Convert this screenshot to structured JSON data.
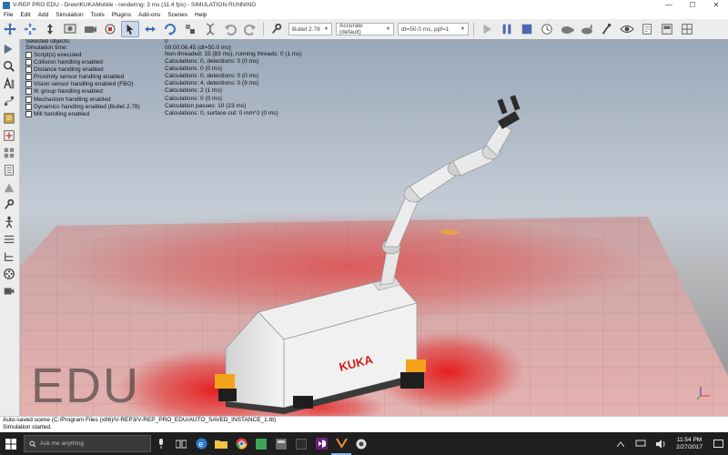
{
  "window": {
    "title": "V-REP PRO EDU - Drew\\KUKAMobile - rendering: 3 ms (11.4 fps) - SIMULATION RUNNING",
    "min_glyph": "—",
    "max_glyph": "☐",
    "close_glyph": "✕"
  },
  "menu": [
    "File",
    "Edit",
    "Add",
    "Simulation",
    "Tools",
    "Plugins",
    "Add-ons",
    "Scenes",
    "Help"
  ],
  "toolbar": {
    "engine": "Bullet 2.78",
    "accuracy": "Accurate (default)",
    "timestep": "dt=50.0 ms, ppf=1"
  },
  "info_rows": [
    {
      "k": "Selected objects:",
      "v": "0",
      "cb": false
    },
    {
      "k": "Simulation time:",
      "v": "00:00:06.45 (dt=50.0 ms)",
      "cb": false
    },
    {
      "k": "Script(s) executed",
      "v": "Non-threaded: 15 (83 ms), running threads: 0 (1 ms)",
      "cb": true
    },
    {
      "k": "Collision handling enabled",
      "v": "Calculations: 0, detections: 0 (0 ms)",
      "cb": true
    },
    {
      "k": "Distance handling enabled",
      "v": "Calculations: 0 (0 ms)",
      "cb": true
    },
    {
      "k": "Proximity sensor handling enabled",
      "v": "Calculations: 0, detections: 0 (0 ms)",
      "cb": true
    },
    {
      "k": "Vision sensor handling enabled (FBO)",
      "v": "Calculations: 4, detections: 0 (9 ms)",
      "cb": true
    },
    {
      "k": "IK group handling enabled",
      "v": "Calculations: 2 (1 ms)",
      "cb": true
    },
    {
      "k": "Mechanism handling enabled",
      "v": "Calculations: 0 (0 ms)",
      "cb": true
    },
    {
      "k": "Dynamics handling enabled (Bullet 2.78)",
      "v": "Calculation passes: 10 (23 ms)",
      "cb": true
    },
    {
      "k": "Mill handling enabled",
      "v": "Calculations: 0, surface cut: 0 mm^2 (0 ms)",
      "cb": true
    }
  ],
  "scene": {
    "watermark": "EDU",
    "robot_logo": "KUKA",
    "floor_color": "#d99a9a",
    "heat_color": "#e01010"
  },
  "status": {
    "line1": "Auto-saved scene (C:/Program Files (x86)/V-REP3/V-REP_PRO_EDU/AUTO_SAVED_INSTANCE_1.ttt)",
    "line2": "Simulation started."
  },
  "taskbar": {
    "search_placeholder": "Ask me anything",
    "time": "11:54 PM",
    "date": "2/27/2017"
  }
}
